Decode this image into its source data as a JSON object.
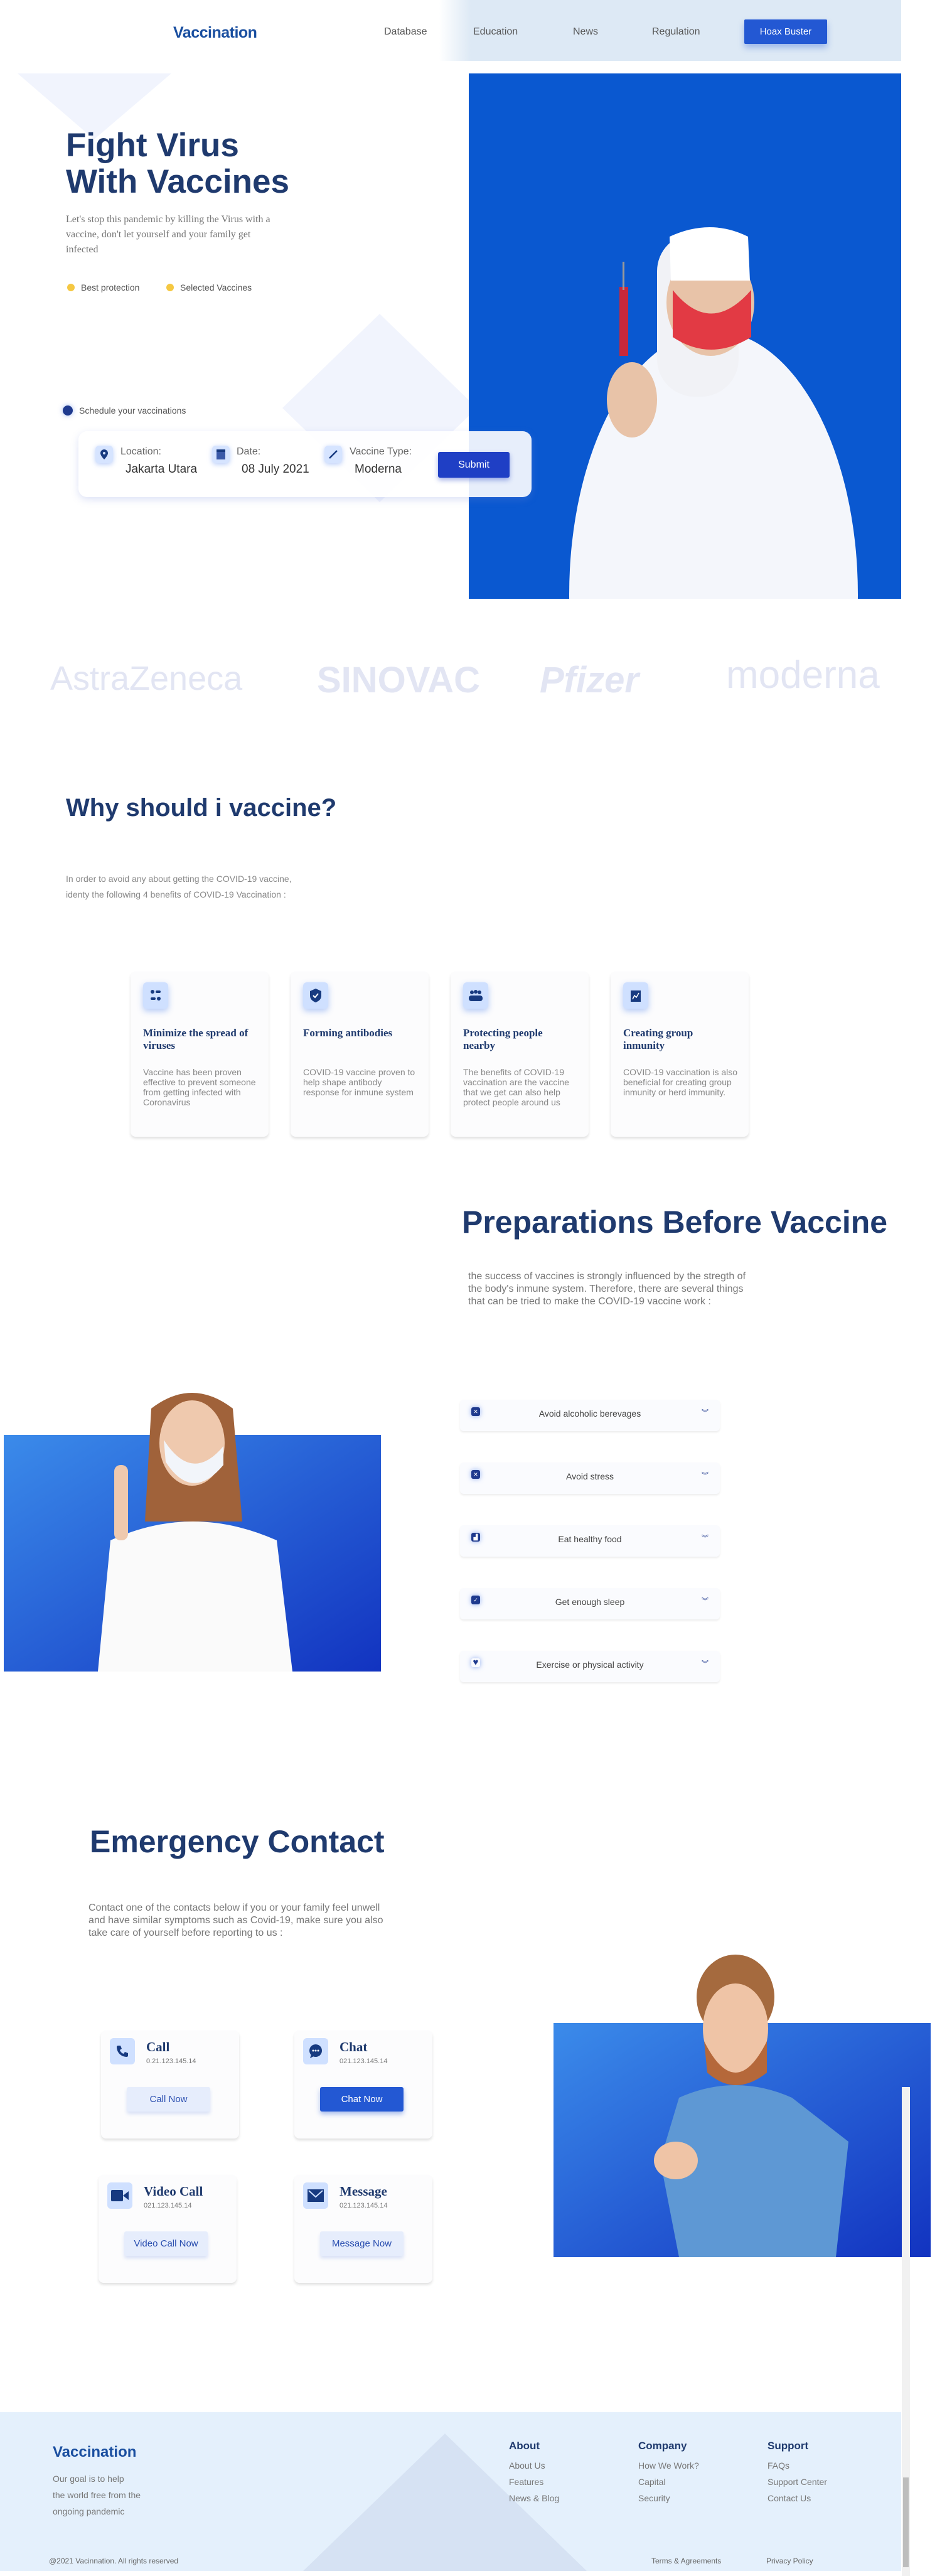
{
  "nav": {
    "brand": "Vaccination",
    "links": [
      "Database",
      "Education",
      "News",
      "Regulation"
    ],
    "cta": "Hoax Buster"
  },
  "hero": {
    "title_line1": "Fight Virus",
    "title_line2": "With Vaccines",
    "lead": "Let's stop this pandemic by killing the Virus with a vaccine, don't let yourself and your family get infected",
    "features": [
      "Best protection",
      "Selected Vaccines"
    ],
    "schedule_label": "Schedule your vaccinations",
    "form": {
      "location_label": "Location:",
      "location_value": "Jakarta Utara",
      "date_label": "Date:",
      "date_value": "08 July 2021",
      "vaccine_label": "Vaccine Type:",
      "vaccine_value": "Moderna",
      "submit": "Submit"
    }
  },
  "brands": [
    "AstraZeneca",
    "SINOVAC",
    "Pfizer",
    "moderna"
  ],
  "why": {
    "title": "Why should i vaccine?",
    "text": "In order to avoid any about getting the COVID-19 vaccine, identy the following 4 benefits of COVID-19 Vaccination :",
    "cards": [
      {
        "icon": "virus-spread-icon",
        "title": "Minimize the spread of viruses",
        "body": "Vaccine has been proven effective to prevent someone from getting infected with Coronavirus"
      },
      {
        "icon": "shield-check-icon",
        "title": "Forming antibodies",
        "body": "COVID-19 vaccine proven to help shape antibody response for inmune system"
      },
      {
        "icon": "people-group-icon",
        "title": "Protecting people nearby",
        "body": "The benefits of COVID-19 vaccination are the vaccine that we get can also help protect people around us"
      },
      {
        "icon": "chart-line-icon",
        "title": "Creating group inmunity",
        "body": "COVID-19 vaccination is also beneficial for creating group inmunity or herd immunity."
      }
    ]
  },
  "prep": {
    "title": "Preparations Before Vaccine",
    "text": "the success of vaccines is strongly influenced by the stregth of the body's inmune system. Therefore, there are several things that can be tried to make the COVID-19 vaccine work :",
    "items": [
      {
        "icon": "shield-x-icon",
        "label": "Avoid alcoholic berevages"
      },
      {
        "icon": "x-square-icon",
        "label": "Avoid stress"
      },
      {
        "icon": "chart-square-icon",
        "label": "Eat healthy food"
      },
      {
        "icon": "check-square-icon",
        "label": "Get enough sleep"
      },
      {
        "icon": "heart-icon",
        "label": "Exercise or physical activity"
      }
    ]
  },
  "emergency": {
    "title": "Emergency Contact",
    "text": "Contact one of the contacts below if you or your family feel unwell and have similar symptoms such as Covid-19, make sure you also take care of yourself before reporting to us :",
    "contacts": [
      {
        "icon": "phone-icon",
        "title": "Call",
        "number": "0.21.123.145.14",
        "button": "Call Now"
      },
      {
        "icon": "chat-bubble-icon",
        "title": "Chat",
        "number": "021.123.145.14",
        "button": "Chat Now"
      },
      {
        "icon": "video-camera-icon",
        "title": "Video Call",
        "number": "021.123.145.14",
        "button": "Video Call Now"
      },
      {
        "icon": "envelope-icon",
        "title": "Message",
        "number": "021.123.145.14",
        "button": "Message Now"
      }
    ]
  },
  "footer": {
    "brand": "Vaccination",
    "tagline": [
      "Our goal is to help",
      "the world free from the",
      "ongoing pandemic"
    ],
    "columns": [
      {
        "title": "About",
        "links": [
          "About Us",
          "Features",
          "News & Blog"
        ]
      },
      {
        "title": "Company",
        "links": [
          "How We Work?",
          "Capital",
          "Security"
        ]
      },
      {
        "title": "Support",
        "links": [
          "FAQs",
          "Support Center",
          "Contact Us"
        ]
      }
    ],
    "copyright": "@2021 Vacinnation. All rights reserved",
    "terms": "Terms & Agreements",
    "privacy": "Privacy Policy"
  },
  "colors": {
    "heading": "#1f3a6e",
    "primary": "#2358d3",
    "hero_bg": "#0a58d0",
    "footer_bg": "#e4f0fc"
  }
}
